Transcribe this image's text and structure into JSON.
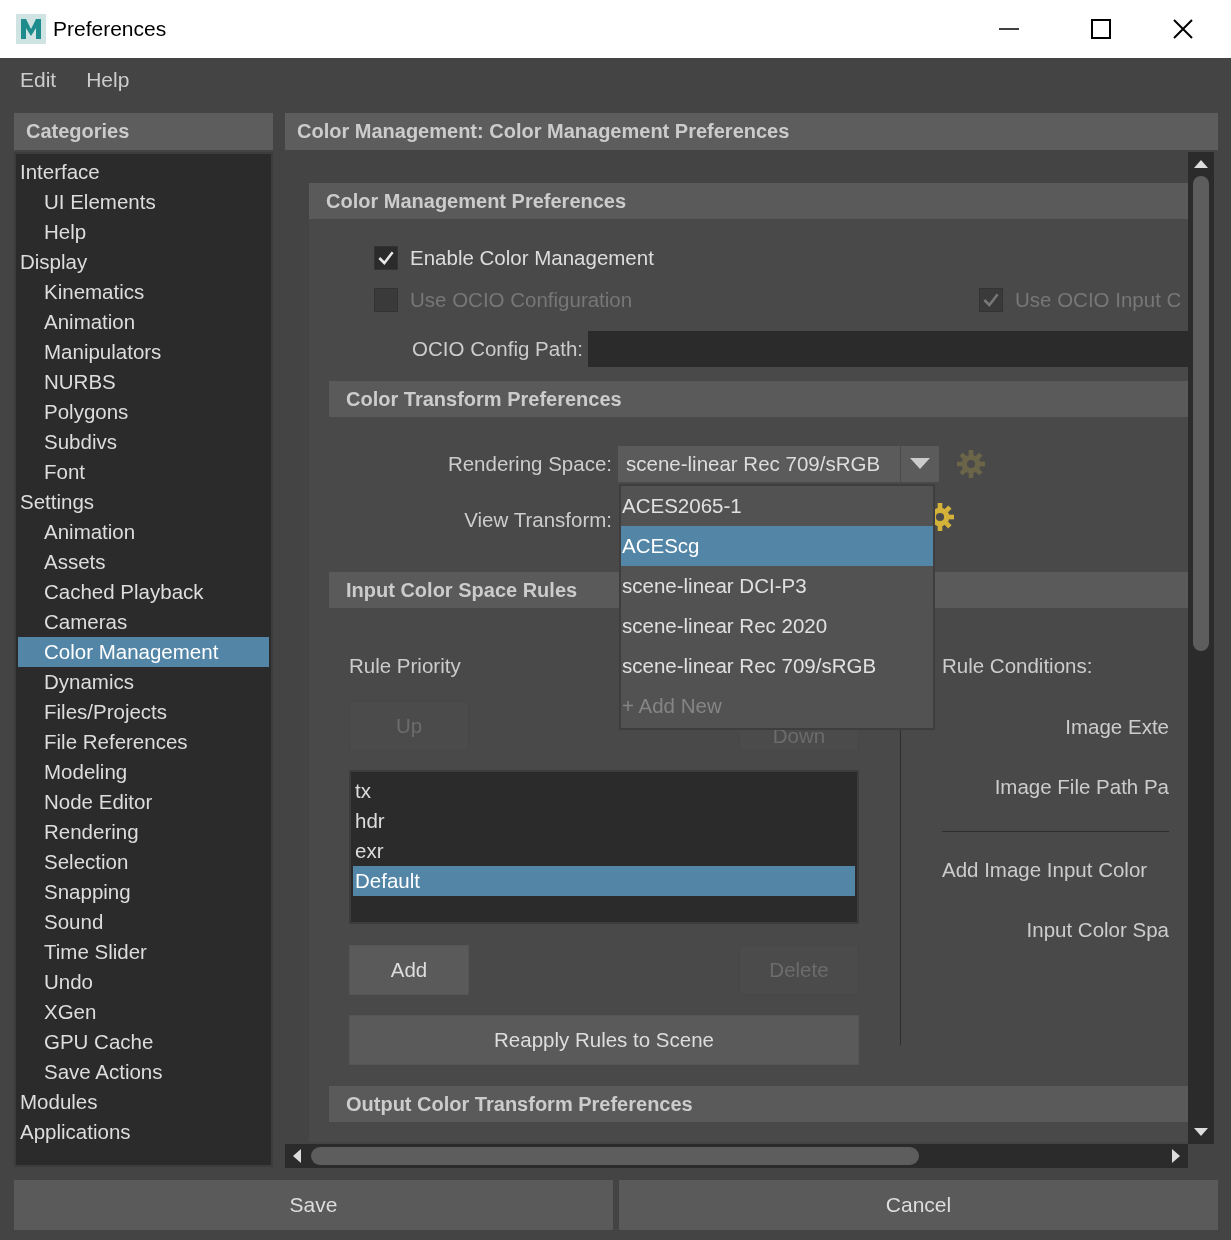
{
  "window": {
    "title": "Preferences"
  },
  "menu": [
    "Edit",
    "Help"
  ],
  "categories": {
    "title": "Categories",
    "items": [
      {
        "label": "Interface",
        "selected": false,
        "children": [
          {
            "label": "UI Elements",
            "selected": false
          },
          {
            "label": "Help",
            "selected": false
          }
        ]
      },
      {
        "label": "Display",
        "selected": false,
        "children": [
          {
            "label": "Kinematics",
            "selected": false
          },
          {
            "label": "Animation",
            "selected": false
          },
          {
            "label": "Manipulators",
            "selected": false
          },
          {
            "label": "NURBS",
            "selected": false
          },
          {
            "label": "Polygons",
            "selected": false
          },
          {
            "label": "Subdivs",
            "selected": false
          },
          {
            "label": "Font",
            "selected": false
          }
        ]
      },
      {
        "label": "Settings",
        "selected": false,
        "children": [
          {
            "label": "Animation",
            "selected": false
          },
          {
            "label": "Assets",
            "selected": false
          },
          {
            "label": "Cached Playback",
            "selected": false
          },
          {
            "label": "Cameras",
            "selected": false
          },
          {
            "label": "Color Management",
            "selected": true
          },
          {
            "label": "Dynamics",
            "selected": false
          },
          {
            "label": "Files/Projects",
            "selected": false
          },
          {
            "label": "File References",
            "selected": false
          },
          {
            "label": "Modeling",
            "selected": false
          },
          {
            "label": "Node Editor",
            "selected": false
          },
          {
            "label": "Rendering",
            "selected": false
          },
          {
            "label": "Selection",
            "selected": false
          },
          {
            "label": "Snapping",
            "selected": false
          },
          {
            "label": "Sound",
            "selected": false
          },
          {
            "label": "Time Slider",
            "selected": false
          },
          {
            "label": "Undo",
            "selected": false
          },
          {
            "label": "XGen",
            "selected": false
          },
          {
            "label": "GPU Cache",
            "selected": false
          },
          {
            "label": "Save Actions",
            "selected": false
          }
        ]
      },
      {
        "label": "Modules",
        "selected": false
      },
      {
        "label": "Applications",
        "selected": false
      }
    ]
  },
  "content": {
    "title": "Color Management: Color Management Preferences",
    "color_management": {
      "title": "Color Management Preferences",
      "enable": {
        "label": "Enable Color Management",
        "checked": true,
        "disabled": false
      },
      "use_ocio": {
        "label": "Use OCIO Configuration",
        "checked": false,
        "disabled": true
      },
      "use_ocio_input": {
        "label": "Use OCIO Input C",
        "checked": true,
        "disabled": true
      },
      "config_path": {
        "label": "OCIO Config Path:"
      }
    },
    "color_transform": {
      "title": "Color Transform Preferences",
      "rendering_space": {
        "label": "Rendering Space:",
        "value": "scene-linear Rec 709/sRGB"
      },
      "view_transform": {
        "label": "View Transform:"
      }
    },
    "dropdown": [
      {
        "label": "ACES2065-1",
        "selected": false,
        "disabled": false
      },
      {
        "label": "ACEScg",
        "selected": true,
        "disabled": false
      },
      {
        "label": "scene-linear DCI-P3",
        "selected": false,
        "disabled": false
      },
      {
        "label": "scene-linear Rec 2020",
        "selected": false,
        "disabled": false
      },
      {
        "label": "scene-linear Rec 709/sRGB",
        "selected": false,
        "disabled": false
      },
      {
        "label": "+ Add New",
        "selected": false,
        "disabled": true
      }
    ],
    "input_rules": {
      "title": "Input Color Space Rules",
      "rule_priority": "Rule Priority",
      "up": {
        "label": "Up",
        "disabled": true
      },
      "down": {
        "label": "Down",
        "disabled": true
      },
      "rules": [
        {
          "label": "tx",
          "selected": false
        },
        {
          "label": "hdr",
          "selected": false
        },
        {
          "label": "exr",
          "selected": false
        },
        {
          "label": "Default",
          "selected": true
        }
      ],
      "add": {
        "label": "Add",
        "disabled": false
      },
      "delete": {
        "label": "Delete",
        "disabled": true
      },
      "reapply": {
        "label": "Reapply Rules to Scene",
        "disabled": false
      },
      "rule_conditions": "Rule Conditions:",
      "image_extension": "Image Exte",
      "image_file_path": "Image File Path Pa",
      "add_image_input": "Add Image Input Color",
      "input_color_space": "Input Color Spa"
    },
    "output": {
      "title": "Output Color Transform Preferences"
    }
  },
  "footer": [
    {
      "label": "Save"
    },
    {
      "label": "Cancel"
    }
  ]
}
